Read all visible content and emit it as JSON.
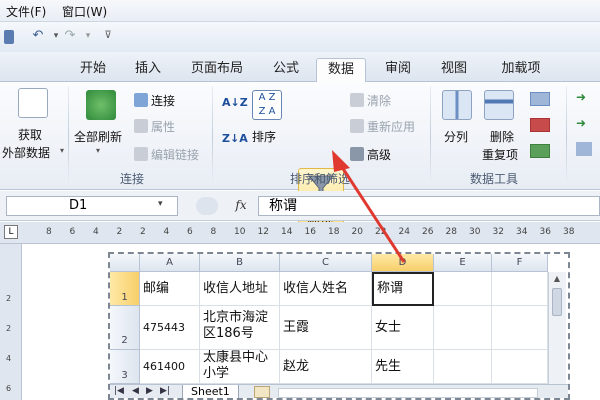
{
  "menu": {
    "file": "文件(F)",
    "window": "窗口(W)"
  },
  "tabs": [
    {
      "label": "开始"
    },
    {
      "label": "插入"
    },
    {
      "label": "页面布局"
    },
    {
      "label": "公式"
    },
    {
      "label": "数据",
      "active": true
    },
    {
      "label": "审阅"
    },
    {
      "label": "视图"
    },
    {
      "label": "加载项"
    }
  ],
  "ribbon": {
    "get_external": "获取",
    "get_external2": "外部数据",
    "refresh_all": "全部刷新",
    "connections": "连接",
    "properties": "属性",
    "edit_links": "编辑链接",
    "group_connections": "连接",
    "sort": "排序",
    "filter": "筛选",
    "clear": "清除",
    "reapply": "重新应用",
    "advanced": "高级",
    "group_sort_filter": "排序和筛选",
    "text_to_columns": "分列",
    "remove_dup": "删除",
    "remove_dup2": "重复项",
    "group_data_tools": "数据工具"
  },
  "formula_bar": {
    "name_box": "D1",
    "fx": "fx",
    "content": "称谓"
  },
  "ruler": {
    "ticks": [
      "8",
      "6",
      "4",
      "2",
      "2",
      "4",
      "6",
      "8",
      "10",
      "12",
      "14",
      "16",
      "18",
      "20",
      "22",
      "24",
      "26",
      "28",
      "30",
      "32",
      "34",
      "36",
      "38"
    ]
  },
  "vruler": {
    "ticks": [
      "2",
      "2",
      "4",
      "6"
    ]
  },
  "sheet": {
    "columns": [
      "A",
      "B",
      "C",
      "D",
      "E",
      "F"
    ],
    "selected_column": "D",
    "rows": [
      {
        "num": "1",
        "cells": [
          "邮编",
          "收信人地址",
          "收信人姓名",
          "称谓",
          "",
          ""
        ]
      },
      {
        "num": "2",
        "cells": [
          "475443",
          "北京市海淀区186号",
          "王霞",
          "女士",
          "",
          ""
        ]
      },
      {
        "num": "3",
        "cells": [
          "461400",
          "太康县中心小学",
          "赵龙",
          "先生",
          "",
          ""
        ]
      }
    ],
    "tab_name": "Sheet1"
  },
  "colors": {
    "active_tab_bg": "#fdfdfe",
    "filter_highlight": "#ffd969",
    "annotation_arrow": "#e0392f"
  }
}
